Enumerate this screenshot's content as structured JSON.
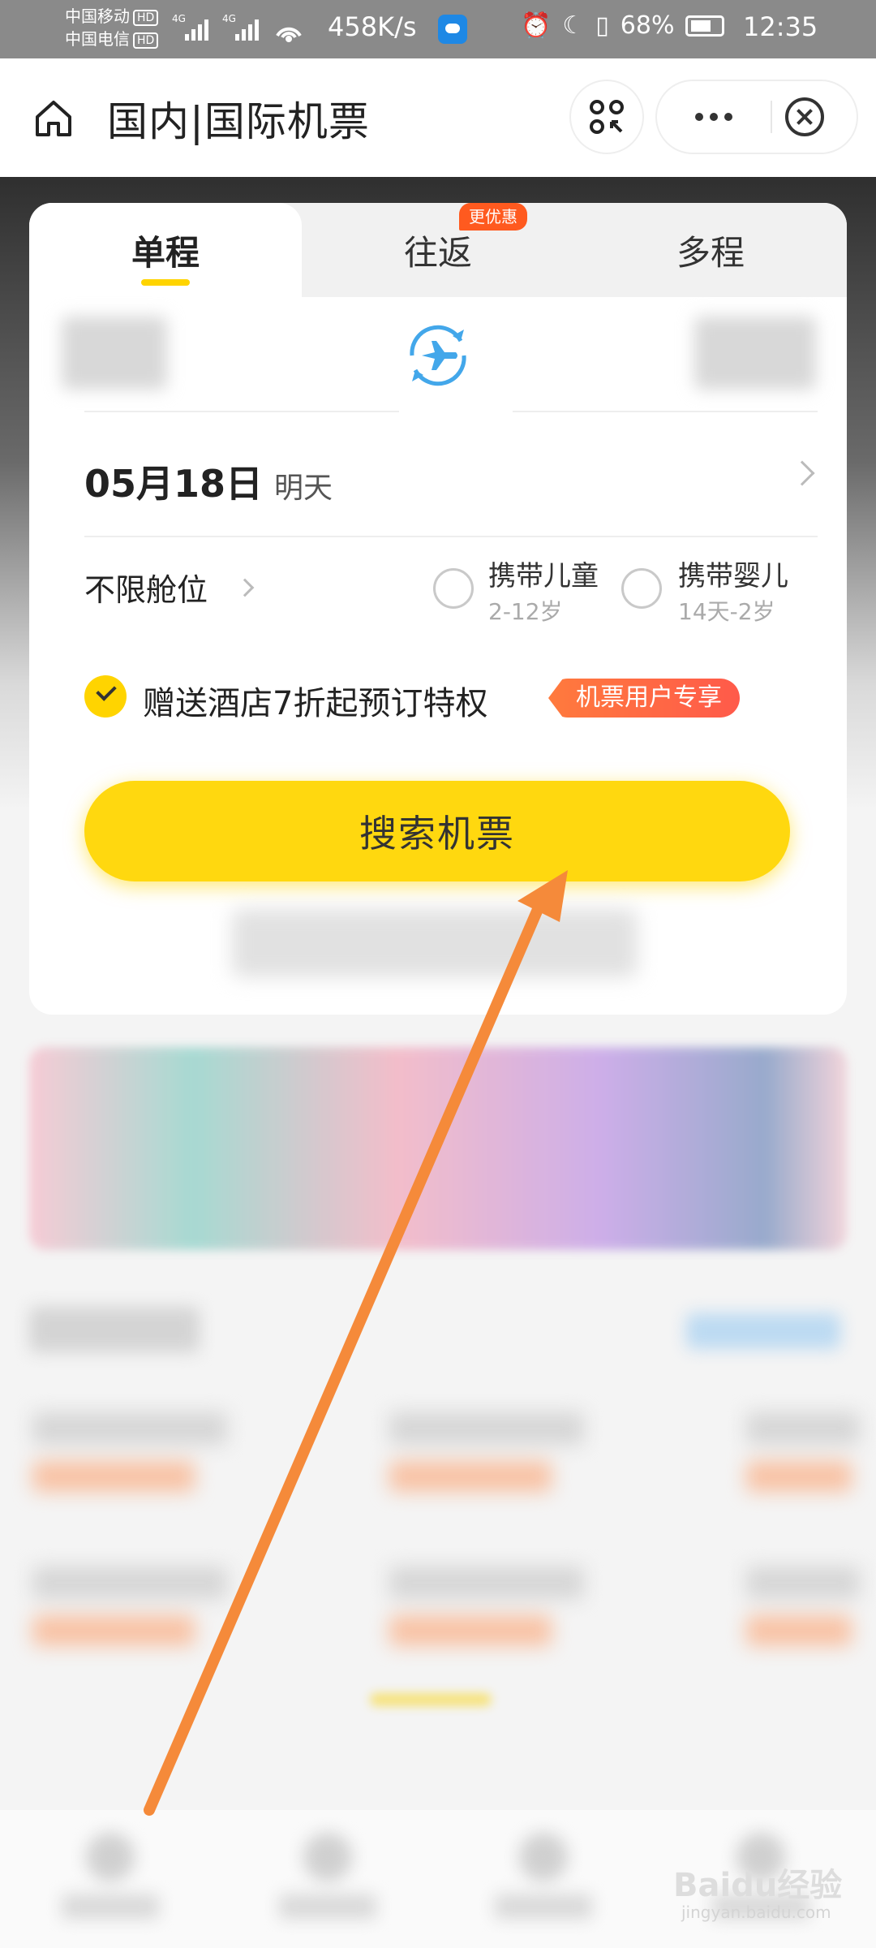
{
  "status_bar": {
    "carrier_1": "中国移动",
    "carrier_2": "中国电信",
    "hd_badge": "HD",
    "network_tag": "4G",
    "net_speed": "458K/s",
    "battery_level": "68%",
    "time": "12:35",
    "icons": [
      "signal-icon",
      "wifi-icon",
      "weather-app-icon",
      "alarm-icon",
      "moon-icon",
      "vibrate-icon",
      "battery-icon"
    ]
  },
  "nav": {
    "title": "国内|国际机票",
    "icons": [
      "home-icon",
      "scan-icon",
      "more-icon",
      "close-icon"
    ]
  },
  "tabs": {
    "one_way": "单程",
    "round_trip": "往返",
    "round_trip_badge": "更优惠",
    "multi_city": "多程"
  },
  "form": {
    "date": "05月18日",
    "date_sub": "明天",
    "cabin": "不限舱位",
    "child_label": "携带儿童",
    "child_sub": "2-12岁",
    "infant_label": "携带婴儿",
    "infant_sub": "14天-2岁",
    "hotel_offer": "赠送酒店7折起预订特权",
    "member_tag": "机票用户专享",
    "search_button": "搜索机票"
  },
  "watermark": {
    "brand": "Baidu经验",
    "url": "jingyan.baidu.com"
  },
  "colors": {
    "accent_yellow": "#ffd80f",
    "tab_indicator": "#ffd400",
    "badge_orange": "#ff5a1f",
    "annotation_arrow": "#f58a3a",
    "plane_blue": "#43a7ea"
  }
}
